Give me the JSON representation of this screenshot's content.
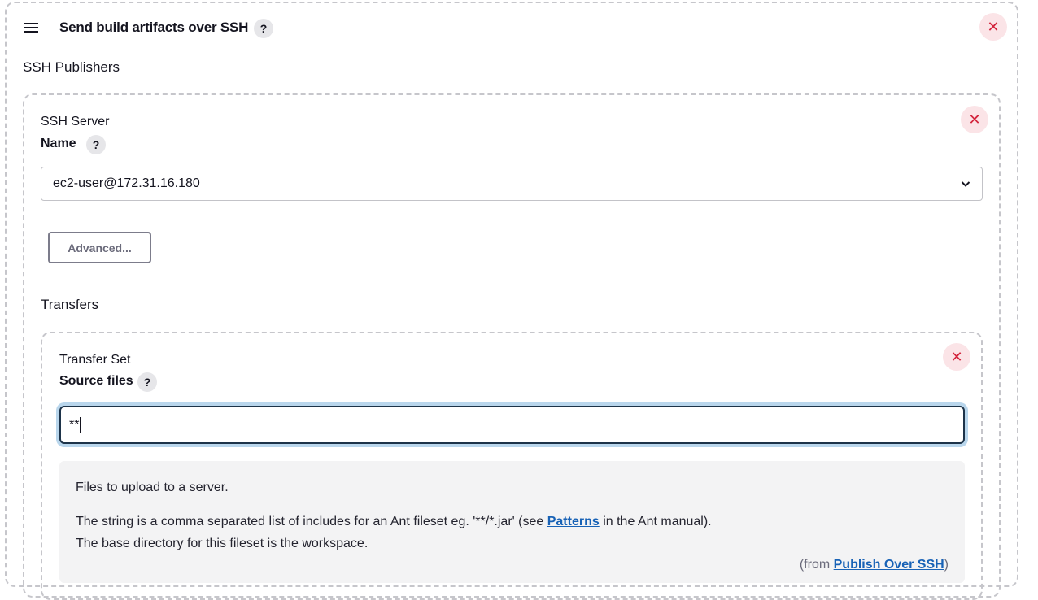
{
  "header": {
    "title": "Send build artifacts over SSH",
    "help_icon": "help-icon",
    "close_icon": "close-icon"
  },
  "publishers": {
    "section_title": "SSH Publishers"
  },
  "server": {
    "heading": "SSH Server",
    "name_label": "Name",
    "name_value": "ec2-user@172.31.16.180",
    "advanced_label": "Advanced..."
  },
  "transfers": {
    "section_title": "Transfers",
    "set_heading": "Transfer Set",
    "source_label": "Source files",
    "source_value": "**"
  },
  "help_text": {
    "line1": "Files to upload to a server.",
    "line2_before": "The string is a comma separated list of includes for an Ant fileset eg. '**/*.jar' (see ",
    "line2_link": "Patterns",
    "line2_after": " in the Ant manual).",
    "line3": "The base directory for this fileset is the workspace.",
    "from_before": "(from ",
    "from_link": "Publish Over SSH",
    "from_after": ")"
  },
  "colors": {
    "close_bg": "#fbe4e7",
    "close_fg": "#d3243c",
    "focus_ring": "#b9d6ec",
    "link": "#1862b6"
  }
}
